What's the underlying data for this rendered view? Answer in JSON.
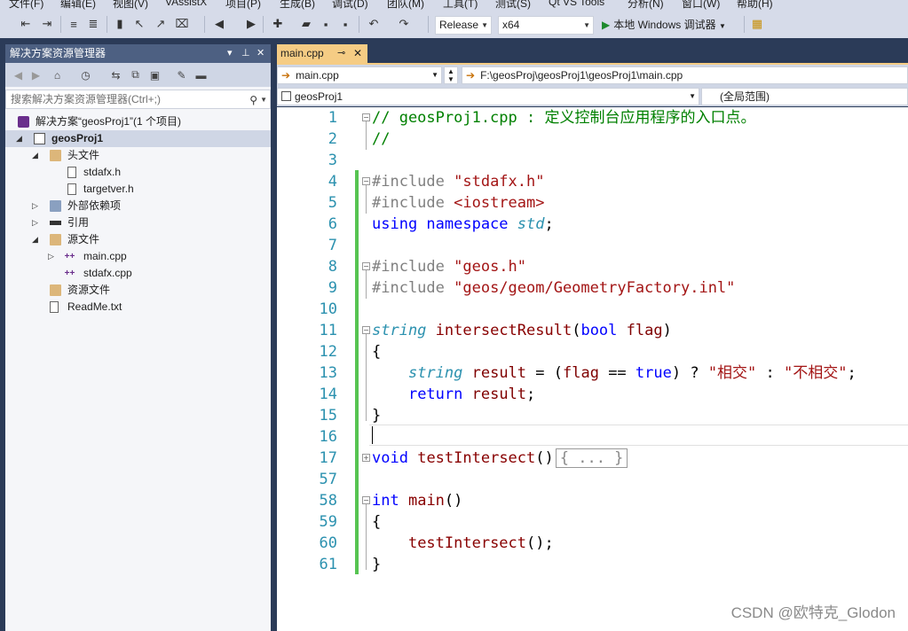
{
  "menu": [
    "文件(F)",
    "编辑(E)",
    "视图(V)",
    "VAssistX",
    "项目(P)",
    "生成(B)",
    "调试(D)",
    "团队(M)",
    "工具(T)",
    "测试(S)",
    "Qt VS Tools",
    "分析(N)",
    "窗口(W)",
    "帮助(H)"
  ],
  "toolbar": {
    "config": "Release",
    "platform": "x64",
    "debugger": "本地 Windows 调试器"
  },
  "solution_explorer": {
    "title": "解决方案资源管理器",
    "search_placeholder": "搜索解决方案资源管理器(Ctrl+;)",
    "items": [
      {
        "label": "解决方案“geosProj1”(1 个项目)"
      },
      {
        "label": "geosProj1"
      },
      {
        "label": "头文件"
      },
      {
        "label": "stdafx.h"
      },
      {
        "label": "targetver.h"
      },
      {
        "label": "外部依赖项"
      },
      {
        "label": "引用"
      },
      {
        "label": "源文件"
      },
      {
        "label": "main.cpp"
      },
      {
        "label": "stdafx.cpp"
      },
      {
        "label": "资源文件"
      },
      {
        "label": "ReadMe.txt"
      }
    ]
  },
  "editor": {
    "tab": "main.cpp",
    "nav_file": "main.cpp",
    "nav_path": "F:\\geosProj\\geosProj1\\geosProj1\\main.cpp",
    "nav_project": "geosProj1",
    "nav_scope": "(全局范围)",
    "line_numbers": [
      "1",
      "2",
      "3",
      "4",
      "5",
      "6",
      "7",
      "8",
      "9",
      "10",
      "11",
      "12",
      "13",
      "14",
      "15",
      "16",
      "17",
      "57",
      "58",
      "59",
      "60",
      "61"
    ]
  },
  "watermark": "CSDN @欧特克_Glodon"
}
